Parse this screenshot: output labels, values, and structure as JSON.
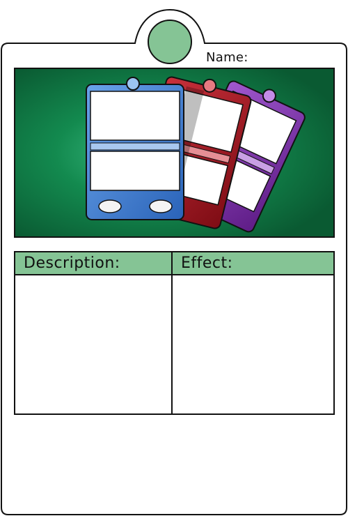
{
  "card": {
    "name_label": "Name:",
    "description_header": "Description:",
    "effect_header": "Effect:",
    "description_text": "",
    "effect_text": ""
  },
  "colors": {
    "accent_green": "#85c495",
    "art_background": "#0b6a3a",
    "outline": "#111111",
    "card_blue": "#3b78c9",
    "card_red": "#a3121c",
    "card_purple": "#7a2aa8"
  },
  "icons": {
    "emblem": "green-circle-emblem",
    "art": "stacked-cards-illustration"
  }
}
